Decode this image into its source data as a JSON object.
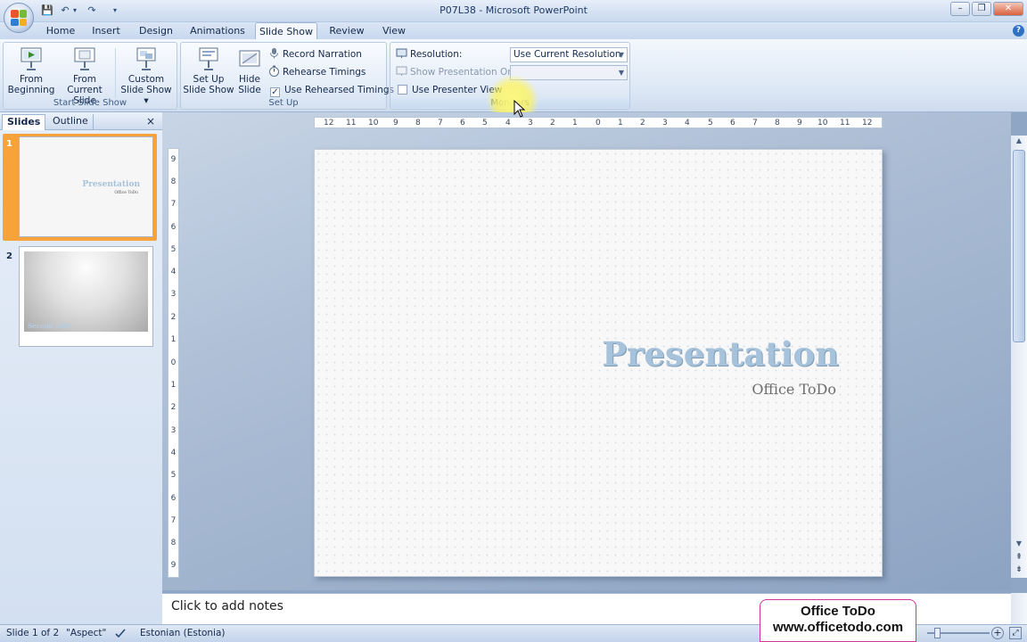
{
  "window": {
    "title": "P07L38 - Microsoft PowerPoint",
    "minimize": "–",
    "restore": "❐",
    "close": "✕"
  },
  "quick_access": {
    "save": "💾",
    "undo": "↶",
    "redo": "↷",
    "customize": "▾",
    "more": "▾"
  },
  "tabs": [
    {
      "label": "Home"
    },
    {
      "label": "Insert"
    },
    {
      "label": "Design"
    },
    {
      "label": "Animations"
    },
    {
      "label": "Slide Show",
      "active": true
    },
    {
      "label": "Review"
    },
    {
      "label": "View"
    }
  ],
  "help": "?",
  "ribbon": {
    "start_group": {
      "label": "Start Slide Show",
      "from_beginning": {
        "line1": "From",
        "line2": "Beginning"
      },
      "from_current": {
        "line1": "From",
        "line2": "Current Slide"
      },
      "custom": {
        "line1": "Custom",
        "line2": "Slide Show ▾"
      }
    },
    "setup_group": {
      "label": "Set Up",
      "setup": {
        "line1": "Set Up",
        "line2": "Slide Show"
      },
      "hide": {
        "line1": "Hide",
        "line2": "Slide"
      },
      "record_narration": "Record Narration",
      "rehearse_timings": "Rehearse Timings",
      "use_rehearsed": "Use Rehearsed Timings",
      "use_rehearsed_checked": "✓"
    },
    "monitors_group": {
      "label": "Monitors",
      "resolution_label": "Resolution:",
      "resolution_value": "Use Current Resolution",
      "show_on_label": "Show Presentation On:",
      "show_on_value": "",
      "presenter_view": "Use Presenter View"
    }
  },
  "panel": {
    "tab_slides": "Slides",
    "tab_outline": "Outline",
    "close": "×",
    "thumbs": [
      {
        "number": "1",
        "title": "Presentation",
        "subtitle": "Office ToDo"
      },
      {
        "number": "2",
        "caption": "Second slide"
      }
    ]
  },
  "ruler_h": [
    "12",
    "11",
    "10",
    "9",
    "8",
    "7",
    "6",
    "5",
    "4",
    "3",
    "2",
    "1",
    "0",
    "1",
    "2",
    "3",
    "4",
    "5",
    "6",
    "7",
    "8",
    "9",
    "10",
    "11",
    "12"
  ],
  "ruler_v": [
    "9",
    "8",
    "7",
    "6",
    "5",
    "4",
    "3",
    "2",
    "1",
    "0",
    "1",
    "2",
    "3",
    "4",
    "5",
    "6",
    "7",
    "8",
    "9"
  ],
  "slide": {
    "title": "Presentation",
    "subtitle": "Office ToDo"
  },
  "notes": {
    "placeholder": "Click to add notes"
  },
  "status": {
    "slide": "Slide 1 of 2",
    "theme": "\"Aspect\"",
    "language": "Estonian (Estonia)"
  },
  "watermark": {
    "line1": "Office ToDo",
    "line2": "www.officetodo.com"
  },
  "colors": {
    "accent_orange": "#f7a23a",
    "ribbon_blue": "#c9d9ee",
    "slide_title": "#a7c3db"
  }
}
